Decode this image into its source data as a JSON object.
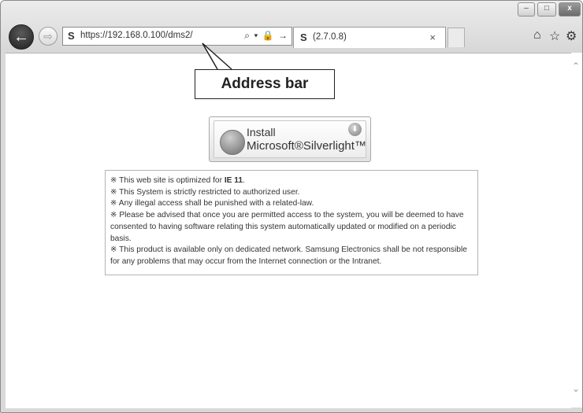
{
  "browser": {
    "url": "https://192.168.0.100/dms2/",
    "favicon": "S",
    "address_tools": "⌕ ▾ 🔒 →",
    "tab_favicon": "S",
    "tab_title": "(2.7.0.8)",
    "tab_close": "×",
    "back_icon": "←",
    "forward_icon": "⇨",
    "window_controls": {
      "minimize": "–",
      "maximize": "□",
      "close": "x"
    },
    "toolbar_icons": {
      "home": "⌂",
      "favorites": "☆",
      "settings": "⚙"
    }
  },
  "callout": {
    "label": "Address bar"
  },
  "silverlight": {
    "line1": "Install",
    "line2": "Microsoft®Silverlight™",
    "download_icon": "⬇"
  },
  "notice": {
    "ie_prefix": "※ This web site is optimized for ",
    "ie_version": "IE 11",
    "ie_suffix": ".",
    "lines": [
      "※ This System is strictly restricted to authorized user.",
      "※ Any illegal access shall be punished with a related-law.",
      "※ Please be advised that once you are permitted access to the system, you will be deemed to have consented to having software relating this system automatically updated or modified on a periodic basis.",
      "※ This product is available only on dedicated network. Samsung Electronics shall be not responsible for any problems that may occur from the Internet connection or the Intranet."
    ]
  },
  "scrollbar": {
    "up": "⌃",
    "down": "⌄"
  }
}
